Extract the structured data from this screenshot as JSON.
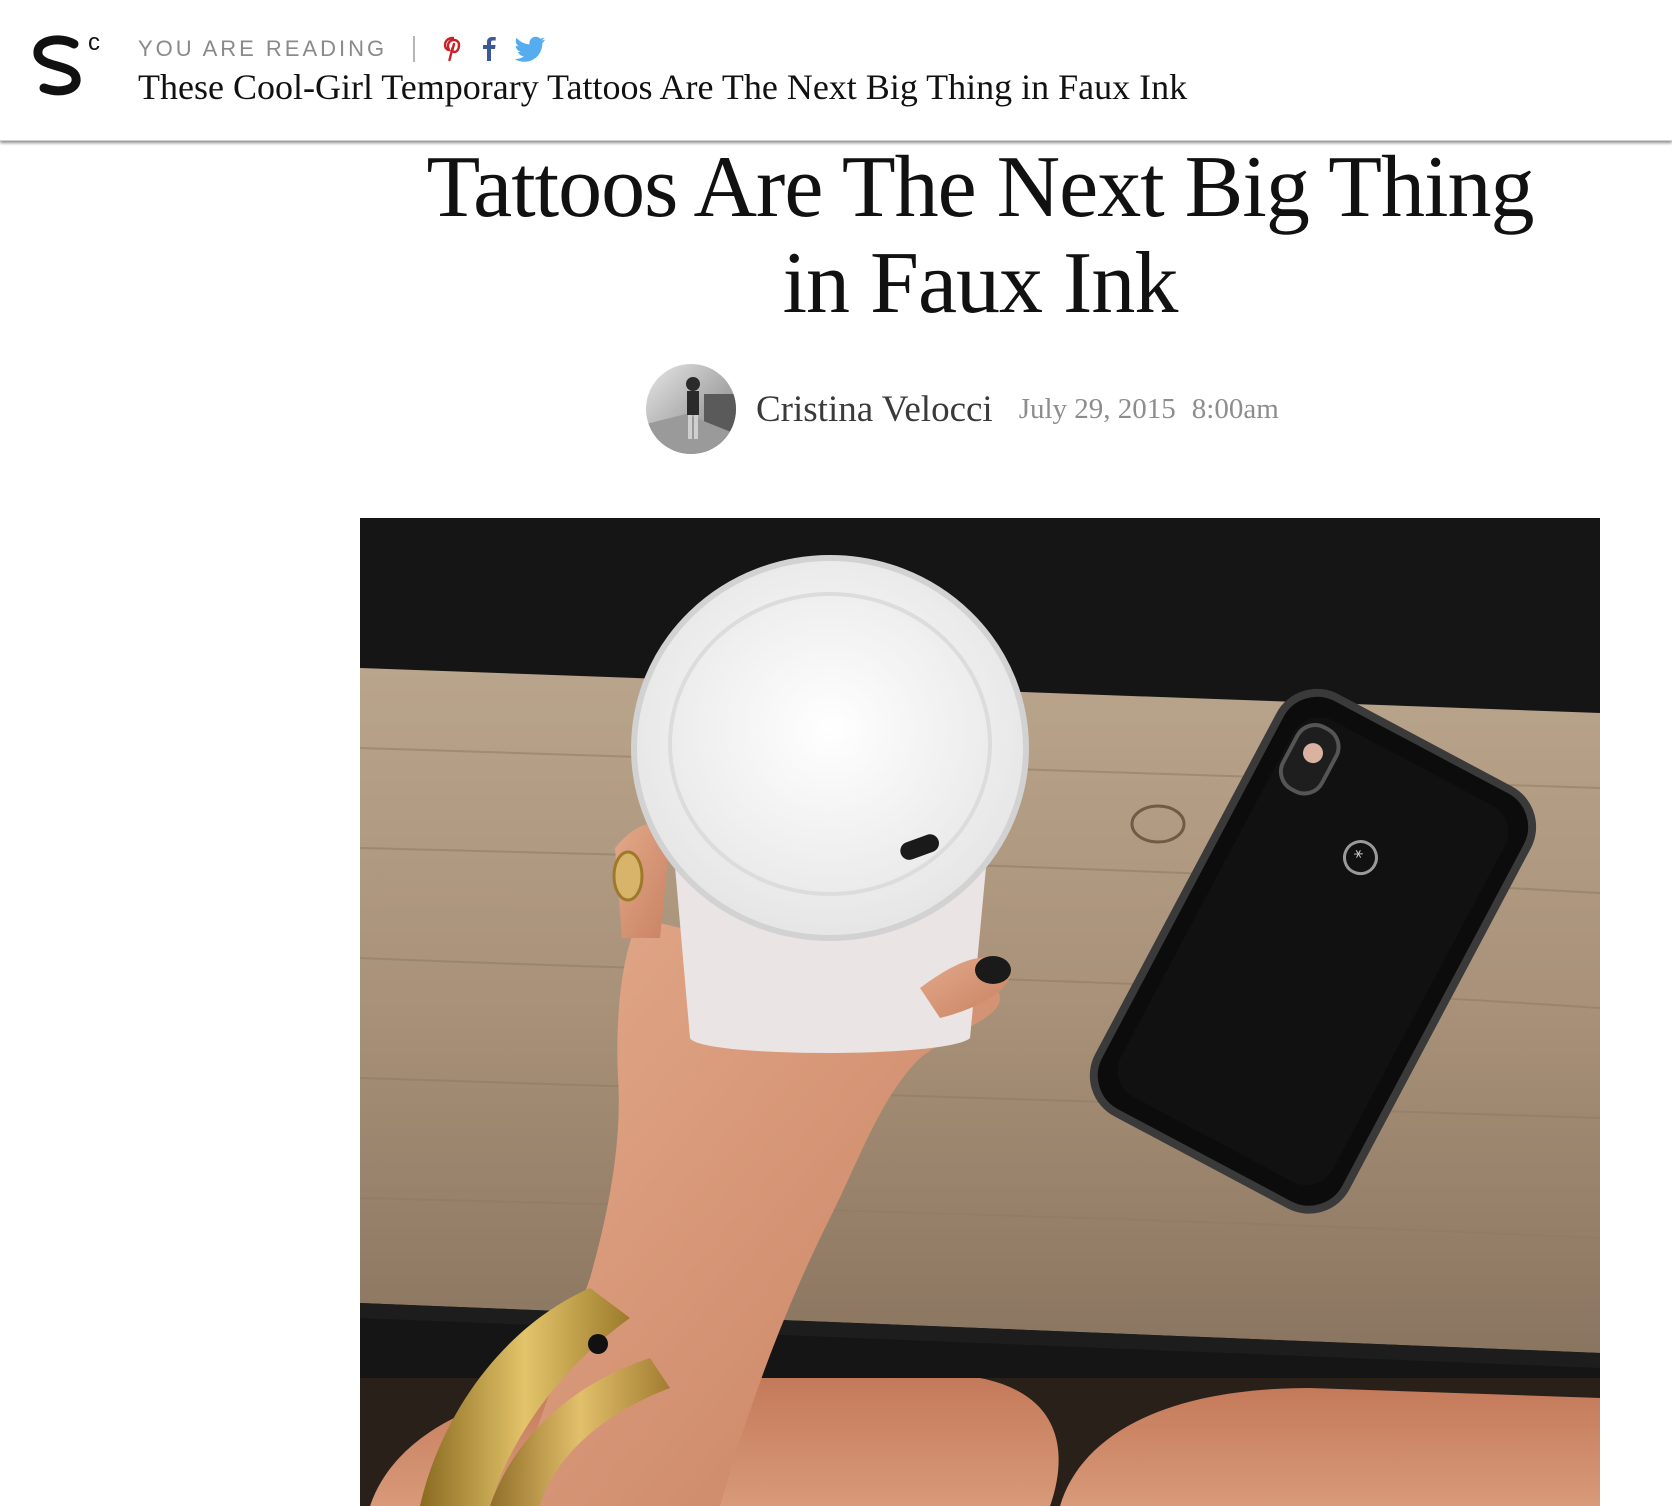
{
  "sticky_header": {
    "reading_label": "YOU ARE READING",
    "title": "These Cool-Girl Temporary Tattoos Are The Next Big Thing in Faux Ink",
    "share_icons": [
      "pinterest-icon",
      "facebook-icon",
      "twitter-icon"
    ],
    "colors": {
      "pinterest": "#cb2027",
      "facebook": "#3b5998",
      "twitter": "#55acee"
    }
  },
  "article": {
    "headline_lines": [
      "Tattoos Are The Next Big Thing",
      "in Faux Ink"
    ],
    "author": "Cristina Velocci",
    "date": "July 29, 2015",
    "time": "8:00am"
  }
}
